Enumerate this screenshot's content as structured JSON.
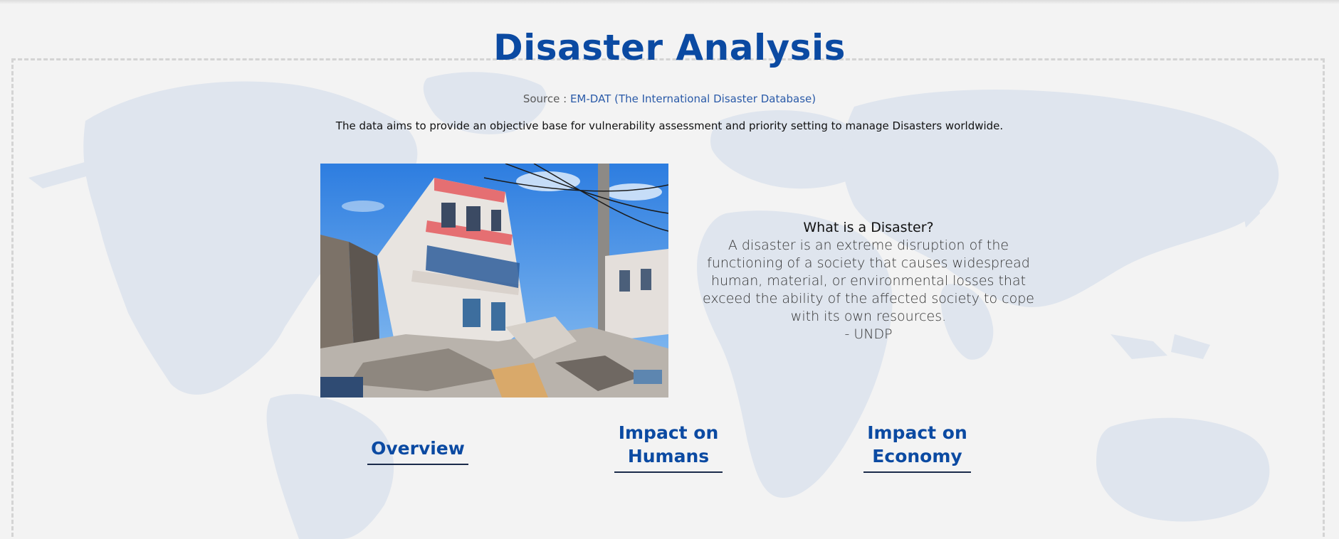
{
  "header": {
    "title": "Disaster Analysis",
    "source_prefix": "Source : ",
    "source_link": "EM-DAT (The International Disaster Database)",
    "tagline": "The data aims to provide an objective base for vulnerability assessment and priority setting to manage Disasters worldwide."
  },
  "definition": {
    "question": "What is a Disaster?",
    "lines": [
      "A disaster is an extreme disruption of the",
      "functioning of a society that causes widespread",
      "human, material, or environmental losses that",
      "exceed the ability of the affected society to cope",
      "with its own resources."
    ],
    "attribution": "- UNDP"
  },
  "nav": {
    "overview": "Overview",
    "humans_line1": "Impact on",
    "humans_line2": "Humans",
    "economy_line1": "Impact on",
    "economy_line2": "Economy"
  },
  "colors": {
    "accent": "#0b4aa2",
    "background": "#f3f3f3",
    "map": "#dfe5ee"
  }
}
